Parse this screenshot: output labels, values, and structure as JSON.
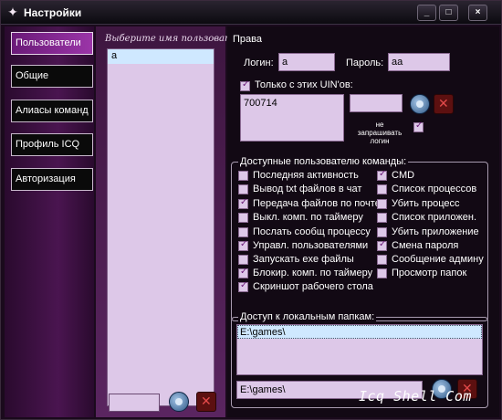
{
  "window": {
    "title": "Настройки",
    "controls": [
      "_",
      "□",
      "×"
    ]
  },
  "nav": {
    "items": [
      {
        "label": "Пользователи",
        "active": true
      },
      {
        "label": "Общие",
        "active": false
      },
      {
        "label": "Алиасы команд",
        "active": false
      },
      {
        "label": "Профиль ICQ",
        "active": false
      },
      {
        "label": "Авторизация",
        "active": false
      }
    ]
  },
  "users": {
    "caption": "Выберите имя пользователя",
    "selected": "a",
    "new_value": ""
  },
  "rights": {
    "section": "Права",
    "login_label": "Логин:",
    "login_value": "a",
    "password_label": "Пароль:",
    "password_value": "aa",
    "uin_checkbox": "Только с этих UIN'ов:",
    "uin_value": "700714",
    "uin_input": "",
    "no_ask_label_1": "не",
    "no_ask_label_2": "запрашивать",
    "no_ask_label_3": "логин"
  },
  "commands": {
    "title": "Доступные пользователю команды:",
    "left": [
      {
        "label": "Последняя активность",
        "checked": false
      },
      {
        "label": "Вывод txt файлов в чат",
        "checked": false
      },
      {
        "label": "Передача файлов по почте",
        "checked": true
      },
      {
        "label": "Выкл. комп. по таймеру",
        "checked": false
      },
      {
        "label": "Послать сообщ процессу",
        "checked": false
      },
      {
        "label": "Управл. пользователями",
        "checked": true
      },
      {
        "label": "Запускать exe файлы",
        "checked": false
      },
      {
        "label": "Блокир. комп. по таймеру",
        "checked": true
      },
      {
        "label": "Скриншот рабочего стола",
        "checked": true
      }
    ],
    "right": [
      {
        "label": "CMD",
        "checked": true
      },
      {
        "label": "Список процессов",
        "checked": false
      },
      {
        "label": "Убить процесс",
        "checked": false
      },
      {
        "label": "Список приложен.",
        "checked": false
      },
      {
        "label": "Убить приложение",
        "checked": false
      },
      {
        "label": "Смена пароля",
        "checked": true
      },
      {
        "label": "Сообщение админу",
        "checked": false
      },
      {
        "label": "Просмотр папок",
        "checked": false
      }
    ]
  },
  "folders": {
    "title": "Доступ к локальным папкам:",
    "items": [
      "E:\\games\\"
    ],
    "input_value": "E:\\games\\"
  },
  "watermark": "Icq Shell Com"
}
